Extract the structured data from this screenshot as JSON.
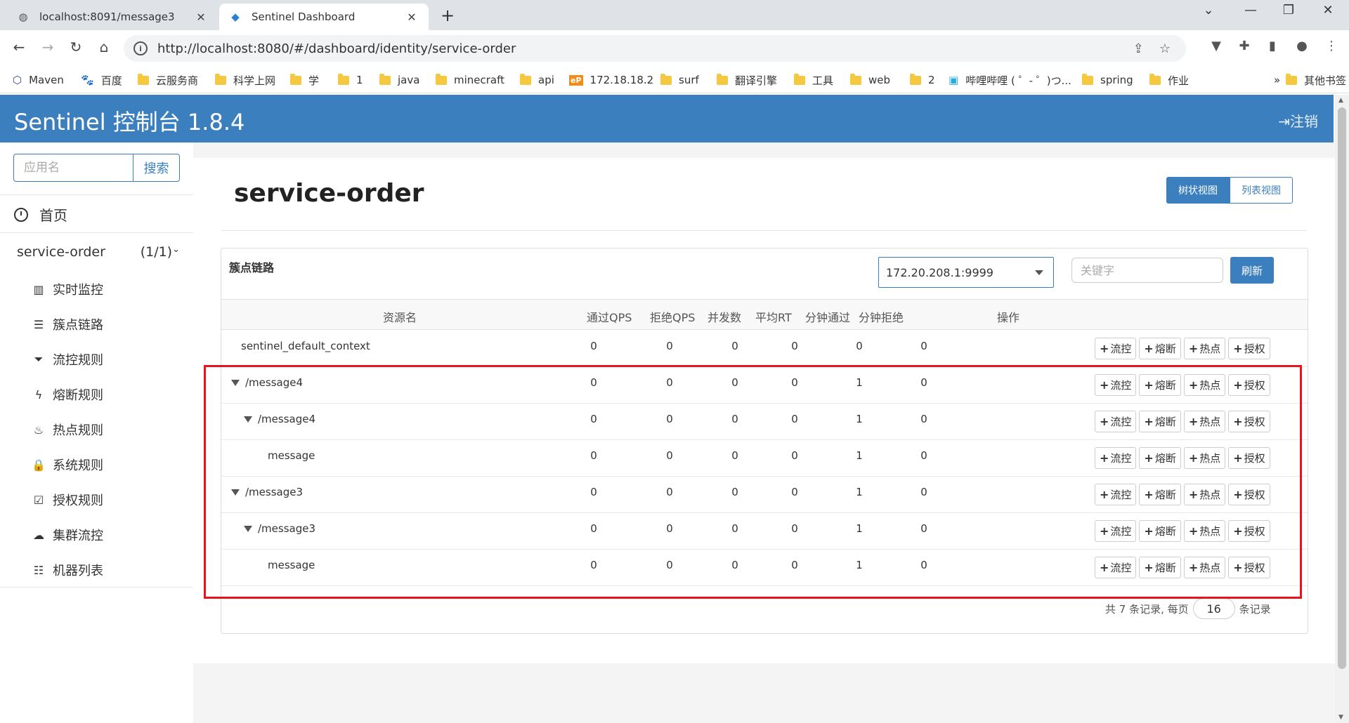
{
  "browser": {
    "tabs": [
      {
        "title": "localhost:8091/message3",
        "icon": "globe-icon"
      },
      {
        "title": "Sentinel Dashboard",
        "icon": "sentinel-icon"
      }
    ],
    "url": "http://localhost:8080/#/dashboard/identity/service-order",
    "bookmarks": [
      {
        "label": "Maven",
        "icon": "maven-icon"
      },
      {
        "label": "百度",
        "icon": "baidu-icon"
      },
      {
        "label": "云服务商",
        "icon": "folder-icon"
      },
      {
        "label": "科学上网",
        "icon": "folder-icon"
      },
      {
        "label": "学",
        "icon": "folder-icon"
      },
      {
        "label": "1",
        "icon": "folder-icon"
      },
      {
        "label": "java",
        "icon": "folder-icon"
      },
      {
        "label": "minecraft",
        "icon": "folder-icon"
      },
      {
        "label": "api",
        "icon": "folder-icon"
      },
      {
        "label": "172.18.18.2",
        "icon": "ep-icon"
      },
      {
        "label": "surf",
        "icon": "folder-icon"
      },
      {
        "label": "翻译引擎",
        "icon": "folder-icon"
      },
      {
        "label": "工具",
        "icon": "folder-icon"
      },
      {
        "label": "web",
        "icon": "folder-icon"
      },
      {
        "label": "2",
        "icon": "folder-icon"
      },
      {
        "label": "哔哩哔哩 ( ゜- ゜)つ...",
        "icon": "bilibili-icon"
      },
      {
        "label": "spring",
        "icon": "folder-icon"
      },
      {
        "label": "作业",
        "icon": "folder-icon"
      }
    ],
    "more_bookmarks": "»",
    "other_bookmarks": "其他书签"
  },
  "header": {
    "title": "Sentinel 控制台 1.8.4",
    "logout": "注销"
  },
  "sidebar": {
    "search_placeholder": "应用名",
    "search_button": "搜索",
    "home": "首页",
    "app_name": "service-order",
    "app_count": "(1/1)",
    "menu": [
      {
        "label": "实时监控",
        "icon": "bar-chart-icon"
      },
      {
        "label": "簇点链路",
        "icon": "list-icon"
      },
      {
        "label": "流控规则",
        "icon": "filter-icon"
      },
      {
        "label": "熔断规则",
        "icon": "flash-icon"
      },
      {
        "label": "热点规则",
        "icon": "fire-icon"
      },
      {
        "label": "系统规则",
        "icon": "lock-icon"
      },
      {
        "label": "授权规则",
        "icon": "check-square-icon"
      },
      {
        "label": "集群流控",
        "icon": "cloud-icon"
      },
      {
        "label": "机器列表",
        "icon": "th-list-icon"
      }
    ]
  },
  "main": {
    "title": "service-order",
    "view_tree": "树状视图",
    "view_list": "列表视图",
    "card_title": "簇点链路",
    "machine": "172.20.208.1:9999",
    "keyword_placeholder": "关键字",
    "refresh": "刷新",
    "columns": [
      "资源名",
      "通过QPS",
      "拒绝QPS",
      "并发数",
      "平均RT",
      "分钟通过",
      "分钟拒绝",
      "操作"
    ],
    "ops": [
      "流控",
      "熔断",
      "热点",
      "授权"
    ],
    "rows": [
      {
        "name": "sentinel_default_context",
        "indent": 0,
        "expand": false,
        "pass_qps": "0",
        "block_qps": "0",
        "threads": "0",
        "avg_rt": "0",
        "min_pass": "0",
        "min_block": "0"
      },
      {
        "name": "/message4",
        "indent": 1,
        "expand": true,
        "pass_qps": "0",
        "block_qps": "0",
        "threads": "0",
        "avg_rt": "0",
        "min_pass": "1",
        "min_block": "0"
      },
      {
        "name": "/message4",
        "indent": 2,
        "expand": true,
        "pass_qps": "0",
        "block_qps": "0",
        "threads": "0",
        "avg_rt": "0",
        "min_pass": "1",
        "min_block": "0"
      },
      {
        "name": "message",
        "indent": 3,
        "expand": false,
        "pass_qps": "0",
        "block_qps": "0",
        "threads": "0",
        "avg_rt": "0",
        "min_pass": "1",
        "min_block": "0"
      },
      {
        "name": "/message3",
        "indent": 1,
        "expand": true,
        "pass_qps": "0",
        "block_qps": "0",
        "threads": "0",
        "avg_rt": "0",
        "min_pass": "1",
        "min_block": "0"
      },
      {
        "name": "/message3",
        "indent": 2,
        "expand": true,
        "pass_qps": "0",
        "block_qps": "0",
        "threads": "0",
        "avg_rt": "0",
        "min_pass": "1",
        "min_block": "0"
      },
      {
        "name": "message",
        "indent": 3,
        "expand": false,
        "pass_qps": "0",
        "block_qps": "0",
        "threads": "0",
        "avg_rt": "0",
        "min_pass": "1",
        "min_block": "0"
      }
    ],
    "pager_prefix": "共 7 条记录, 每页",
    "page_size": "16",
    "pager_suffix": "条记录"
  },
  "colors": {
    "brand": "#3c7fbf",
    "highlight": "#e3161d"
  }
}
